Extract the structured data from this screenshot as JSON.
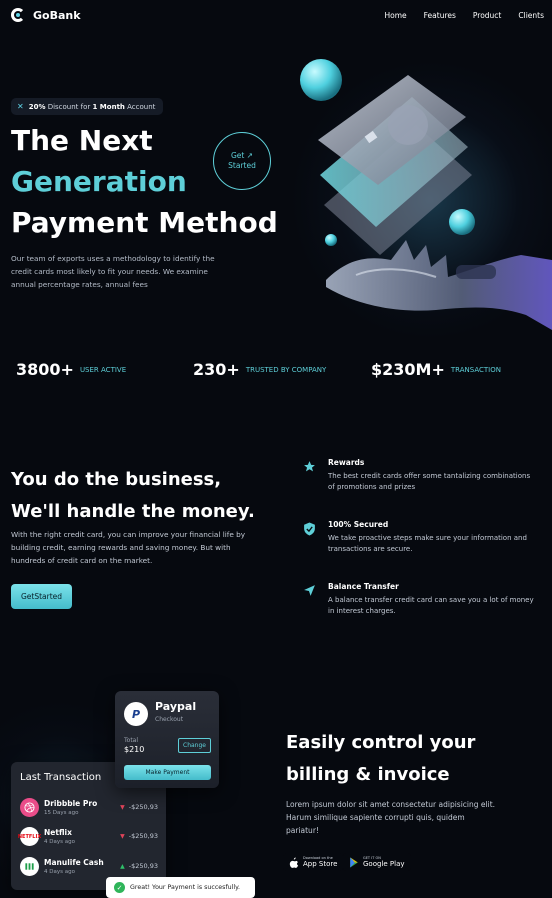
{
  "brand": {
    "name": "GoBank"
  },
  "nav": {
    "items": [
      "Home",
      "Features",
      "Product",
      "Clients"
    ]
  },
  "hero": {
    "promo_percent": "20%",
    "promo_mid": " Discount for ",
    "promo_strong": "1 Month",
    "promo_tail": " Account",
    "title_line1": "The Next",
    "title_line2": "Generation",
    "title_line3": "Payment Method",
    "description": "Our team of exports uses a methodology to identify the credit cards most likely to fit your needs. We examine annual percentage rates, annual fees",
    "cta_line1": "Get",
    "cta_line2": "Started",
    "cta_arrow": "↗"
  },
  "stats": [
    {
      "value": "3800+",
      "label": "USER ACTIVE"
    },
    {
      "value": "230+",
      "label": "TRUSTED BY COMPANY"
    },
    {
      "value": "$230M+",
      "label": "TRANSACTION"
    }
  ],
  "business": {
    "title_line1": "You do the business,",
    "title_line2": "We'll handle the money.",
    "description": "With the right credit card, you can improve your financial life by building credit, earning rewards and saving money. But with hundreds of credit card on the market.",
    "button": "GetStarted",
    "features": [
      {
        "title": "Rewards",
        "text": "The best credit cards offer some tantalizing combinations of promotions and prizes",
        "icon": "star-icon"
      },
      {
        "title": "100% Secured",
        "text": "We take proactive steps make sure your information and transactions are secure.",
        "icon": "shield-icon"
      },
      {
        "title": "Balance Transfer",
        "text": "A balance transfer credit card can save you a lot of money in interest charges.",
        "icon": "send-icon"
      }
    ]
  },
  "billing": {
    "title_line1": "Easily control your",
    "title_line2": "billing & invoice",
    "description": "Lorem ipsum dolor sit amet consectetur adipisicing elit. Harum similique sapiente corrupti quis, quidem pariatur!",
    "appstore_small": "Download on the",
    "appstore_big": "App Store",
    "googleplay_small": "GET IT ON",
    "googleplay_big": "Google Play"
  },
  "paypal": {
    "title": "Paypal",
    "subtitle": "Checkout",
    "total_label": "Total",
    "total_value": "$210",
    "change_button": "Change",
    "make_payment_button": "Make Payment"
  },
  "transactions": {
    "title": "Last Transaction",
    "items": [
      {
        "name": "Dribbble Pro",
        "date": "15 Days ago",
        "amount": "-$250,93",
        "direction": "down",
        "color": "#ea4c89"
      },
      {
        "name": "Netflix",
        "date": "4 Days ago",
        "amount": "-$250,93",
        "direction": "down",
        "color": "#e50914"
      },
      {
        "name": "Manulife Cash",
        "date": "4 Days ago",
        "amount": "-$250,93",
        "direction": "up",
        "color": "#1e9e4a"
      }
    ]
  },
  "toast": {
    "message": "Great! Your Payment is succesfully."
  },
  "colors": {
    "accent": "#5ecfd8",
    "background": "#06090f",
    "down": "#e0445a",
    "up": "#2fc06a"
  }
}
